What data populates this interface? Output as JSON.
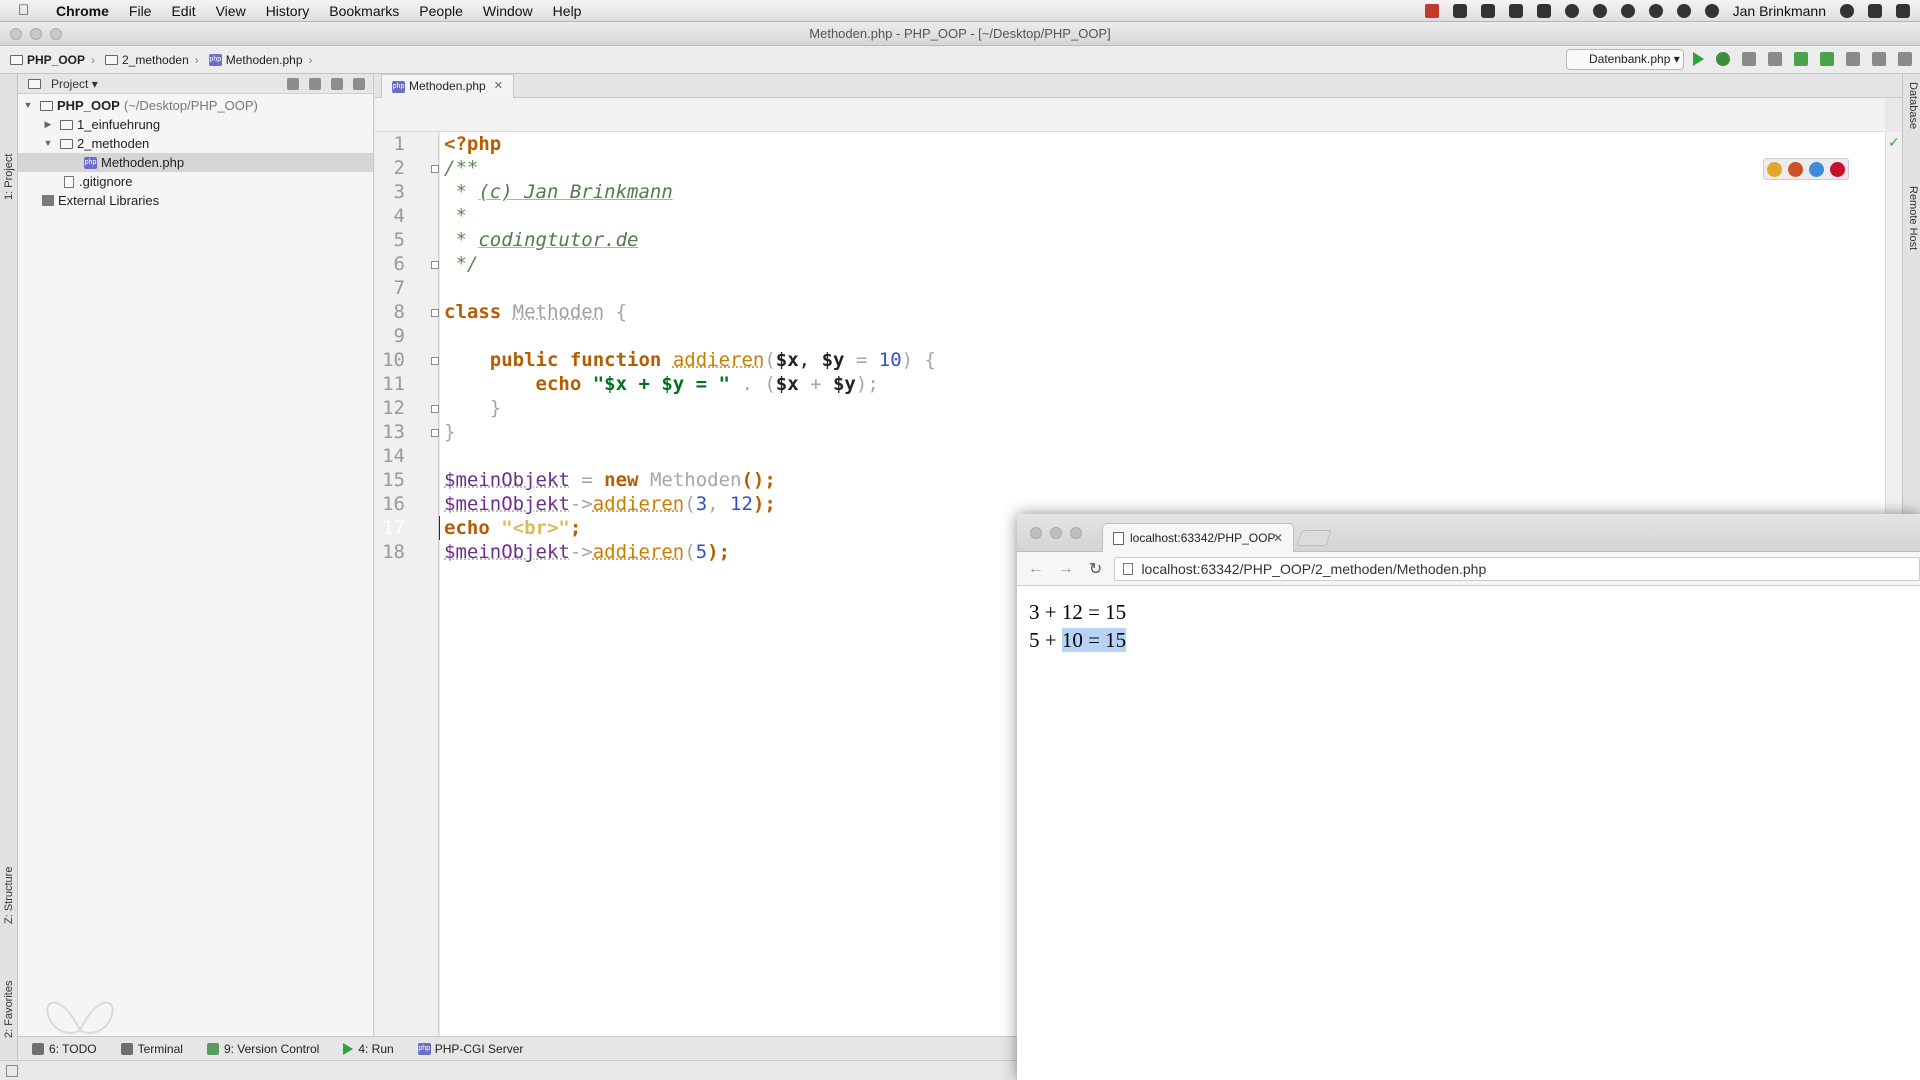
{
  "menubar": {
    "app_name": "Chrome",
    "items": [
      "File",
      "Edit",
      "View",
      "History",
      "Bookmarks",
      "People",
      "Window",
      "Help"
    ],
    "user": "Jan Brinkmann"
  },
  "window": {
    "title": "Methoden.php - PHP_OOP - [~/Desktop/PHP_OOP]"
  },
  "breadcrumb": {
    "items": [
      "PHP_OOP",
      "2_methoden",
      "Methoden.php"
    ]
  },
  "toolbar": {
    "run_config": "Datenbank.php"
  },
  "left_stripe": {
    "project_tab": "1: Project",
    "structure_tab": "Z: Structure",
    "favorites_tab": "2: Favorites"
  },
  "right_stripe": {
    "database_tab": "Database",
    "remote_host_tab": "Remote Host"
  },
  "project_panel": {
    "header": "Project",
    "tree": [
      {
        "label": "PHP_OOP",
        "suffix": "(~/Desktop/PHP_OOP)"
      },
      {
        "label": "1_einfuehrung"
      },
      {
        "label": "2_methoden"
      },
      {
        "label": "Methoden.php"
      },
      {
        "label": ".gitignore"
      },
      {
        "label": "External Libraries"
      }
    ]
  },
  "editor": {
    "tab_label": "Methoden.php",
    "highlighted_line": 17,
    "line_numbers": [
      "1",
      "2",
      "3",
      "4",
      "5",
      "6",
      "7",
      "8",
      "9",
      "10",
      "11",
      "12",
      "13",
      "14",
      "15",
      "16",
      "17",
      "18"
    ],
    "code": {
      "l1": "<?php",
      "l2": "/**",
      "l3_prefix": " * ",
      "l3_text": "(c) Jan Brinkmann",
      "l4": " *",
      "l5_prefix": " * ",
      "l5_text": "codingtutor.de",
      "l6": " */",
      "l8_kw": "class",
      "l8_name": "Methoden",
      "l8_brace": " {",
      "l10_indent": "    ",
      "l10_kw": "public function",
      "l10_fn": "addieren",
      "l10_open": "(",
      "l10_x": "$x",
      "l10_comma": ", ",
      "l10_y": "$y",
      "l10_eq": " = ",
      "l10_num": "10",
      "l10_close": ") {",
      "l11_indent": "        ",
      "l11_kw": "echo",
      "l11_str": " \"$x + $y = \"",
      "l11_dot": " . (",
      "l11_x": "$x",
      "l11_plus": " + ",
      "l11_y": "$y",
      "l11_end": ");",
      "l12": "    }",
      "l13": "}",
      "l15_var": "$meinObjekt",
      "l15_eq": " = ",
      "l15_new": "new",
      "l15_cls": " Methoden",
      "l15_end": "();",
      "l16_var": "$meinObjekt",
      "l16_arrow": "->",
      "l16_fn": "addieren",
      "l16_open": "(",
      "l16_a": "3",
      "l16_comma": ", ",
      "l16_b": "12",
      "l16_end": ");",
      "l17_kw": "echo",
      "l17_str": " \"<br>\"",
      "l17_end": ";",
      "l18_var": "$meinObjekt",
      "l18_arrow": "->",
      "l18_fn": "addieren",
      "l18_open": "(",
      "l18_a": "5",
      "l18_end": ");"
    }
  },
  "bottom_tools": [
    {
      "label": "6: TODO"
    },
    {
      "label": "Terminal"
    },
    {
      "label": "9: Version Control"
    },
    {
      "label": "4: Run"
    },
    {
      "label": "PHP-CGI Server"
    }
  ],
  "browser": {
    "tab_title": "localhost:63342/PHP_OOP",
    "url": "localhost:63342/PHP_OOP/2_methoden/Methoden.php",
    "output_line1": "3 + 12 = 15",
    "output_line2_plain": "5 + ",
    "output_line2_selected": "10 = 15"
  },
  "colors": {
    "keyword": "#000080",
    "string": "#00731f",
    "comment": "#5b8a55",
    "function": "#c87f00",
    "number": "#2f4fcc",
    "selection": "#b6d3f6",
    "current_line": "#2b2b2b"
  }
}
